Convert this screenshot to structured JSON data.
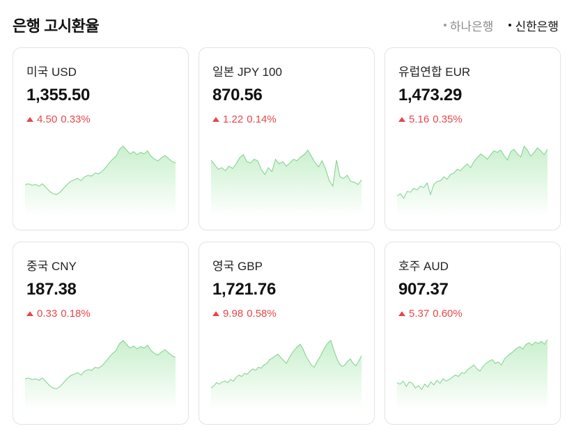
{
  "header": {
    "title": "은행 고시환율",
    "banks": [
      {
        "label": "하나은행",
        "active": false
      },
      {
        "label": "신한은행",
        "active": true
      }
    ]
  },
  "colors": {
    "up": "#e8464a",
    "chart_line": "#7fd18a",
    "chart_fill_top": "#c9f0cd",
    "chart_fill_bottom": "#ffffff"
  },
  "cards": [
    {
      "name": "미국 USD",
      "rate": "1,355.50",
      "change": "4.50",
      "pct": "0.33%",
      "direction": "up"
    },
    {
      "name": "일본 JPY 100",
      "rate": "870.56",
      "change": "1.22",
      "pct": "0.14%",
      "direction": "up"
    },
    {
      "name": "유럽연합 EUR",
      "rate": "1,473.29",
      "change": "5.16",
      "pct": "0.35%",
      "direction": "up"
    },
    {
      "name": "중국 CNY",
      "rate": "187.38",
      "change": "0.33",
      "pct": "0.18%",
      "direction": "up"
    },
    {
      "name": "영국 GBP",
      "rate": "1,721.76",
      "change": "9.98",
      "pct": "0.58%",
      "direction": "up"
    },
    {
      "name": "호주 AUD",
      "rate": "907.37",
      "change": "5.37",
      "pct": "0.60%",
      "direction": "up"
    }
  ],
  "chart_data": [
    {
      "type": "area",
      "series": [
        {
          "values": [
            40,
            41,
            39,
            40,
            38,
            41,
            36,
            31,
            28,
            27,
            30,
            35,
            40,
            44,
            46,
            48,
            45,
            50,
            52,
            51,
            55,
            54,
            57,
            62,
            68,
            73,
            77,
            86,
            90,
            85,
            80,
            83,
            79,
            82,
            80,
            84,
            77,
            73,
            71,
            75,
            78,
            74,
            70,
            68
          ]
        }
      ]
    },
    {
      "type": "area",
      "series": [
        {
          "values": [
            72,
            66,
            60,
            62,
            58,
            64,
            61,
            67,
            75,
            79,
            70,
            68,
            73,
            71,
            60,
            53,
            62,
            57,
            73,
            67,
            70,
            64,
            68,
            73,
            71,
            76,
            79,
            85,
            77,
            69,
            63,
            71,
            60,
            45,
            38,
            72,
            50,
            48,
            52,
            44,
            43,
            40,
            46
          ]
        }
      ]
    },
    {
      "type": "area",
      "series": [
        {
          "values": [
            25,
            28,
            22,
            31,
            30,
            35,
            33,
            38,
            36,
            42,
            27,
            40,
            44,
            45,
            50,
            47,
            53,
            55,
            60,
            58,
            63,
            67,
            62,
            70,
            75,
            80,
            77,
            73,
            79,
            84,
            82,
            85,
            78,
            72,
            83,
            86,
            80,
            76,
            90,
            85,
            77,
            82,
            88,
            84,
            79,
            86
          ]
        }
      ]
    },
    {
      "type": "area",
      "series": [
        {
          "values": [
            40,
            41,
            39,
            40,
            38,
            41,
            36,
            31,
            28,
            27,
            30,
            35,
            40,
            44,
            46,
            48,
            45,
            50,
            52,
            51,
            55,
            54,
            57,
            62,
            68,
            73,
            77,
            86,
            90,
            85,
            80,
            83,
            79,
            82,
            80,
            84,
            77,
            73,
            71,
            75,
            78,
            74,
            70,
            68
          ]
        }
      ]
    },
    {
      "type": "area",
      "series": [
        {
          "values": [
            28,
            31,
            35,
            33,
            36,
            37,
            35,
            39,
            37,
            42,
            45,
            43,
            47,
            46,
            50,
            53,
            51,
            55,
            54,
            58,
            60,
            65,
            67,
            70,
            72,
            68,
            64,
            60,
            67,
            73,
            78,
            82,
            85,
            79,
            70,
            64,
            58,
            55,
            62,
            68,
            75,
            82,
            87,
            90,
            78,
            68,
            60,
            56,
            58,
            63,
            66,
            60,
            57,
            63,
            70
          ]
        }
      ]
    },
    {
      "type": "area",
      "series": [
        {
          "values": [
            35,
            33,
            37,
            30,
            36,
            34,
            28,
            31,
            26,
            33,
            29,
            36,
            32,
            38,
            34,
            40,
            37,
            39,
            42,
            45,
            43,
            48,
            47,
            52,
            55,
            58,
            53,
            50,
            56,
            60,
            63,
            65,
            60,
            62,
            58,
            66,
            70,
            73,
            76,
            80,
            82,
            79,
            85,
            87,
            84,
            88,
            86,
            89,
            85,
            91
          ]
        }
      ]
    }
  ]
}
